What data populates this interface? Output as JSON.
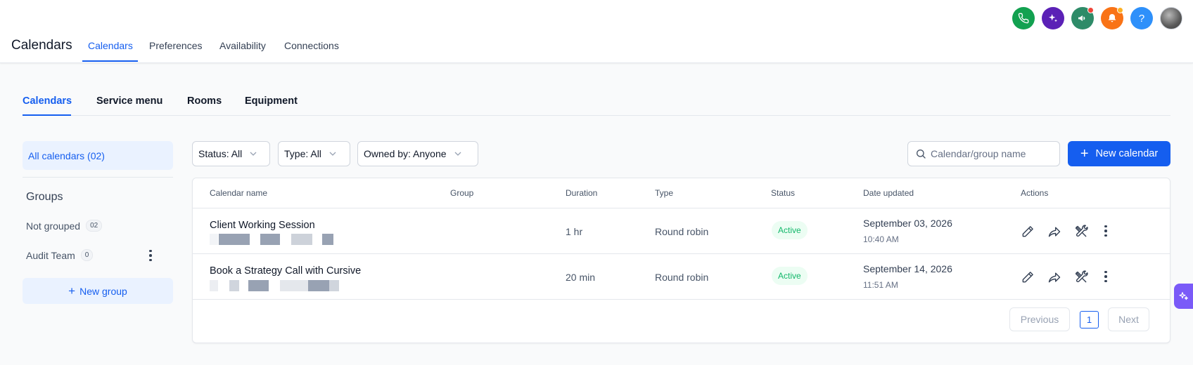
{
  "header": {
    "title": "Calendars",
    "tabs": [
      {
        "label": "Calendars",
        "active": true
      },
      {
        "label": "Preferences",
        "active": false
      },
      {
        "label": "Availability",
        "active": false
      },
      {
        "label": "Connections",
        "active": false
      }
    ],
    "icons": [
      {
        "name": "phone-icon",
        "color": "#12a150"
      },
      {
        "name": "sparkle-icon",
        "color": "#5b21b6"
      },
      {
        "name": "megaphone-icon",
        "color": "#2e8b68"
      },
      {
        "name": "bell-icon",
        "color": "#f97316"
      },
      {
        "name": "help-icon",
        "color": "#2e90fa",
        "glyph": "?"
      },
      {
        "name": "avatar",
        "color": "#6b6b6b"
      }
    ]
  },
  "subtabs": [
    {
      "label": "Calendars",
      "active": true
    },
    {
      "label": "Service menu",
      "active": false
    },
    {
      "label": "Rooms",
      "active": false
    },
    {
      "label": "Equipment",
      "active": false
    }
  ],
  "sidebar": {
    "all_calendars": "All calendars (02)",
    "groups_title": "Groups",
    "groups": [
      {
        "label": "Not grouped",
        "count": "02"
      },
      {
        "label": "Audit Team",
        "count": "0"
      }
    ],
    "new_group": "New group"
  },
  "filters": {
    "status": "Status: All",
    "type": "Type: All",
    "owner": "Owned by: Anyone"
  },
  "search": {
    "placeholder": "Calendar/group name",
    "value": ""
  },
  "new_calendar_label": "New calendar",
  "table": {
    "columns": [
      "Calendar name",
      "Group",
      "Duration",
      "Type",
      "Status",
      "Date updated",
      "Actions"
    ],
    "rows": [
      {
        "name": "Client Working Session",
        "group": "",
        "duration": "1 hr",
        "type": "Round robin",
        "status": "Active",
        "date": "September 03, 2026",
        "time": "10:40 AM"
      },
      {
        "name": "Book a Strategy Call with Cursive",
        "group": "",
        "duration": "20 min",
        "type": "Round robin",
        "status": "Active",
        "date": "September 14, 2026",
        "time": "11:51 AM"
      }
    ]
  },
  "pagination": {
    "previous": "Previous",
    "page": "1",
    "next": "Next"
  },
  "colors": {
    "accent": "#155eef",
    "status_active": "#12b76a"
  }
}
